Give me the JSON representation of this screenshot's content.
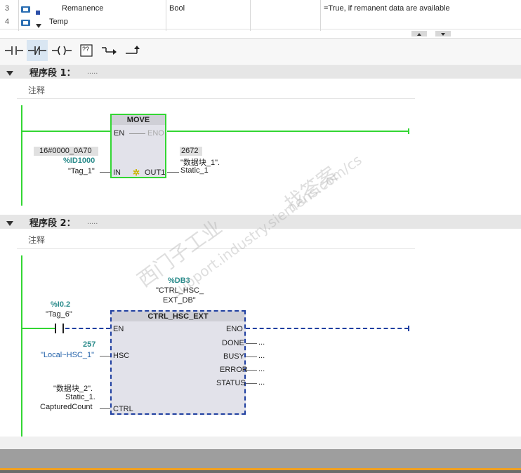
{
  "table": {
    "rows": [
      {
        "num": "3",
        "name": "Remanence",
        "type": "Bool",
        "comment": "=True, if remanent data are available",
        "expanded": false
      },
      {
        "num": "4",
        "name": "Temp",
        "type": "",
        "comment": "",
        "expanded": true
      }
    ]
  },
  "toolbar": {
    "icons": [
      "no-contact-icon",
      "nc-contact-icon",
      "coil-icon",
      "empty-box-icon",
      "open-branch-icon",
      "close-branch-icon"
    ],
    "empty_box_label": "??"
  },
  "networks": [
    {
      "title": "程序段 1：",
      "dots": ".....",
      "comment": "注释",
      "block": {
        "name": "MOVE",
        "en": "EN",
        "eno": "ENO",
        "in_pin": "IN",
        "out_pin": "OUT1",
        "in_value": "16#0000_0A70",
        "in_address": "%ID1000",
        "in_tag": "\"Tag_1\"",
        "out_value": "2672",
        "out_tag_line1": "\"数据块_1\".",
        "out_tag_line2": "Static_1"
      }
    },
    {
      "title": "程序段 2：",
      "dots": ".....",
      "comment": "注释",
      "block": {
        "db_address": "%DB3",
        "db_name_line1": "\"CTRL_HSC_",
        "db_name_line2": "EXT_DB\"",
        "name": "CTRL_HSC_EXT",
        "en": "EN",
        "eno": "ENO",
        "contact_address": "%I0.2",
        "contact_tag": "\"Tag_6\"",
        "hsc_pin": "HSC",
        "hsc_value": "257",
        "hsc_tag": "\"Local~HSC_1\"",
        "ctrl_pin": "CTRL",
        "ctrl_tag_line1": "\"数据块_2\".",
        "ctrl_tag_line2": "Static_1.",
        "ctrl_tag_line3": "CapturedCount",
        "outputs": [
          "DONE",
          "BUSY",
          "ERROR",
          "STATUS"
        ],
        "output_placeholder": "..."
      }
    }
  ],
  "watermark": {
    "line1": "西门子工业",
    "line2": "找答案",
    "line3": "support.industry.siemens.com/cs"
  },
  "colors": {
    "power_rail": "#33d633",
    "block_border_ok": "#33d633",
    "block_border_dashed": "#1f3fa0",
    "address_teal": "#2a8b8b",
    "tag_blue": "#1f5fa8",
    "status_bar": "#9e9e9e",
    "status_accent": "#f0a020"
  }
}
